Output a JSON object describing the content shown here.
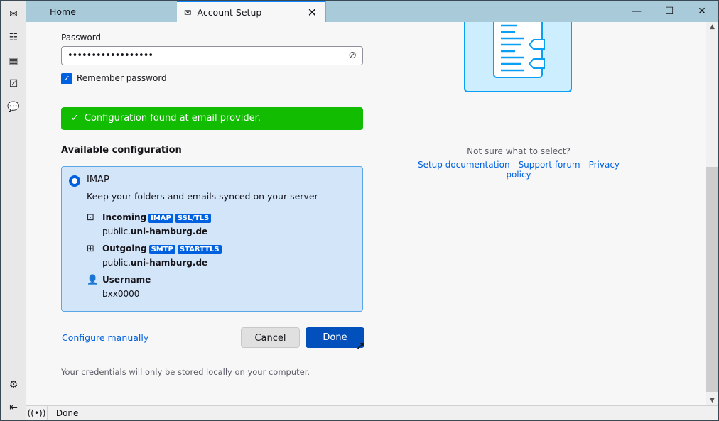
{
  "tabs": [
    {
      "label": "Home"
    },
    {
      "label": "Account Setup"
    }
  ],
  "window_controls": {
    "minimize": "—",
    "maximize": "☐",
    "close": "✕"
  },
  "form": {
    "password_label": "Password",
    "password_value": "••••••••••••••••••",
    "remember_label": "Remember password",
    "remember_checked": true,
    "banner": "Configuration found at email provider.",
    "banner_color": "#12bc00",
    "available_heading": "Available configuration"
  },
  "config": {
    "protocol": "IMAP",
    "description": "Keep your folders and emails synced on your server",
    "incoming": {
      "label": "Incoming",
      "badges": [
        "IMAP",
        "SSL/TLS"
      ],
      "host_prefix": "public.",
      "host_domain": "uni-hamburg.de"
    },
    "outgoing": {
      "label": "Outgoing",
      "badges": [
        "SMTP",
        "STARTTLS"
      ],
      "host_prefix": "public.",
      "host_domain": "uni-hamburg.de"
    },
    "username": {
      "label": "Username",
      "value": "bxx0000"
    }
  },
  "actions": {
    "configure_manually": "Configure manually",
    "cancel": "Cancel",
    "done": "Done"
  },
  "note": "Your credentials will only be stored locally on your computer.",
  "help": {
    "question": "Not sure what to select?",
    "links": [
      "Setup documentation",
      "Support forum",
      "Privacy policy"
    ],
    "separator": " - "
  },
  "status": {
    "text": "Done"
  },
  "colors": {
    "accent": "#0061e0",
    "primary_button": "#0250bb",
    "titlebar": "#a9cad8"
  }
}
